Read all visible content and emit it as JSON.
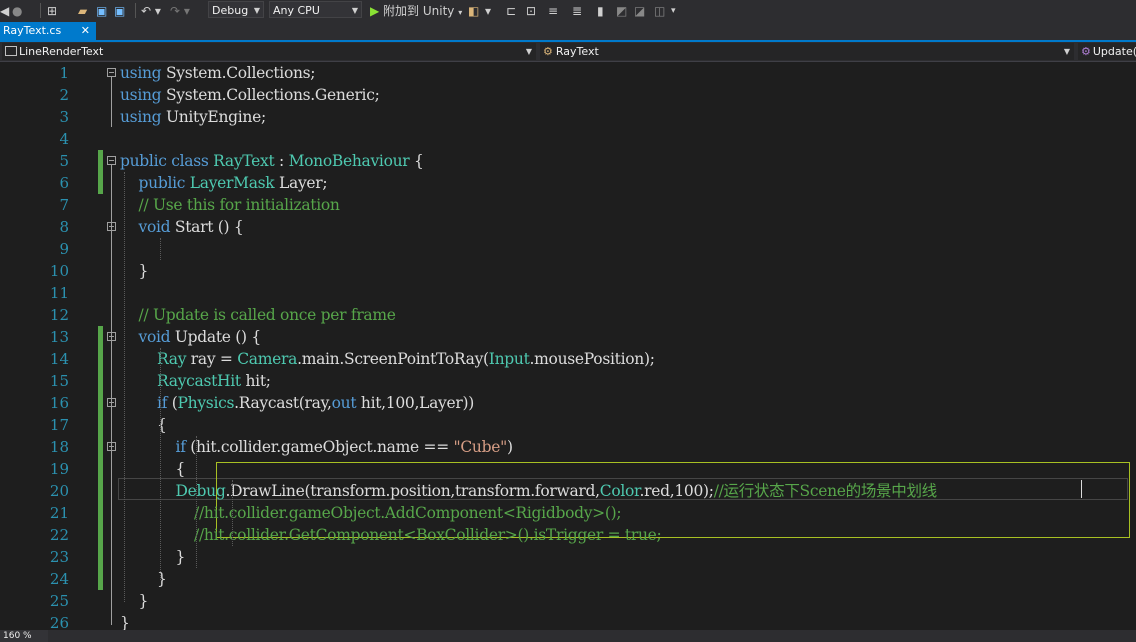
{
  "toolbar": {
    "config": "Debug",
    "platform": "Any CPU",
    "attach_label": "附加到 Unity"
  },
  "tab": {
    "title": "RayText.cs",
    "close": "✕"
  },
  "navbar": {
    "project": "LineRenderText",
    "class": "RayText",
    "member": "Update()"
  },
  "code": {
    "line_numbers": [
      "1",
      "2",
      "3",
      "4",
      "5",
      "6",
      "7",
      "8",
      "9",
      "10",
      "11",
      "12",
      "13",
      "14",
      "15",
      "16",
      "17",
      "18",
      "19",
      "20",
      "21",
      "22",
      "23",
      "24",
      "25",
      "26"
    ],
    "lines": [
      [
        [
          "kw",
          "using"
        ],
        [
          "pl",
          " System.Collections;"
        ]
      ],
      [
        [
          "kw",
          "using"
        ],
        [
          "pl",
          " System.Collections.Generic;"
        ]
      ],
      [
        [
          "kw",
          "using"
        ],
        [
          "pl",
          " UnityEngine;"
        ]
      ],
      [],
      [
        [
          "kw",
          "public class "
        ],
        [
          "ty",
          "RayText"
        ],
        [
          "pl",
          " : "
        ],
        [
          "ty",
          "MonoBehaviour"
        ],
        [
          "pl",
          " {"
        ]
      ],
      [
        [
          "pl",
          "    "
        ],
        [
          "kw",
          "public "
        ],
        [
          "ty",
          "LayerMask"
        ],
        [
          "pl",
          " Layer;"
        ]
      ],
      [
        [
          "pl",
          "    "
        ],
        [
          "cm",
          "// Use this for initialization"
        ]
      ],
      [
        [
          "pl",
          "    "
        ],
        [
          "kw",
          "void"
        ],
        [
          "pl",
          " Start () {"
        ]
      ],
      [],
      [
        [
          "pl",
          "    }"
        ]
      ],
      [],
      [
        [
          "pl",
          "    "
        ],
        [
          "cm",
          "// Update is called once per frame"
        ]
      ],
      [
        [
          "pl",
          "    "
        ],
        [
          "kw",
          "void"
        ],
        [
          "pl",
          " Update () {"
        ]
      ],
      [
        [
          "pl",
          "        "
        ],
        [
          "ty",
          "Ray"
        ],
        [
          "pl",
          " ray = "
        ],
        [
          "ty",
          "Camera"
        ],
        [
          "pl",
          ".main.ScreenPointToRay("
        ],
        [
          "ty",
          "Input"
        ],
        [
          "pl",
          ".mousePosition);"
        ]
      ],
      [
        [
          "pl",
          "        "
        ],
        [
          "ty",
          "RaycastHit"
        ],
        [
          "pl",
          " hit;"
        ]
      ],
      [
        [
          "pl",
          "        "
        ],
        [
          "kw",
          "if"
        ],
        [
          "pl",
          " ("
        ],
        [
          "ty",
          "Physics"
        ],
        [
          "pl",
          ".Raycast(ray,"
        ],
        [
          "kw",
          "out"
        ],
        [
          "pl",
          " hit,100,Layer))"
        ]
      ],
      [
        [
          "pl",
          "        {"
        ]
      ],
      [
        [
          "pl",
          "            "
        ],
        [
          "kw",
          "if"
        ],
        [
          "pl",
          " (hit.collider.gameObject.name == "
        ],
        [
          "st",
          "\"Cube\""
        ],
        [
          "pl",
          ")"
        ]
      ],
      [
        [
          "pl",
          "            {"
        ]
      ],
      [
        [
          "pl",
          "            "
        ],
        [
          "ty",
          "Debug"
        ],
        [
          "pl",
          ".DrawLine(transform.position,transform.forward,"
        ],
        [
          "ty",
          "Color"
        ],
        [
          "pl",
          ".red,100);"
        ],
        [
          "cm",
          "//运行状态下Scene的场景中划线"
        ]
      ],
      [
        [
          "pl",
          "                "
        ],
        [
          "cm",
          "//hit.collider.gameObject.AddComponent<Rigidbody>();"
        ]
      ],
      [
        [
          "pl",
          "                "
        ],
        [
          "cm",
          "//hit.collider.GetComponent<BoxCollider>().isTrigger = true;"
        ]
      ],
      [
        [
          "pl",
          "            }"
        ]
      ],
      [
        [
          "pl",
          "        }"
        ]
      ],
      [
        [
          "pl",
          "    }"
        ]
      ],
      [
        [
          "pl",
          "}"
        ]
      ]
    ]
  },
  "status": {
    "zoom": "160 %"
  }
}
